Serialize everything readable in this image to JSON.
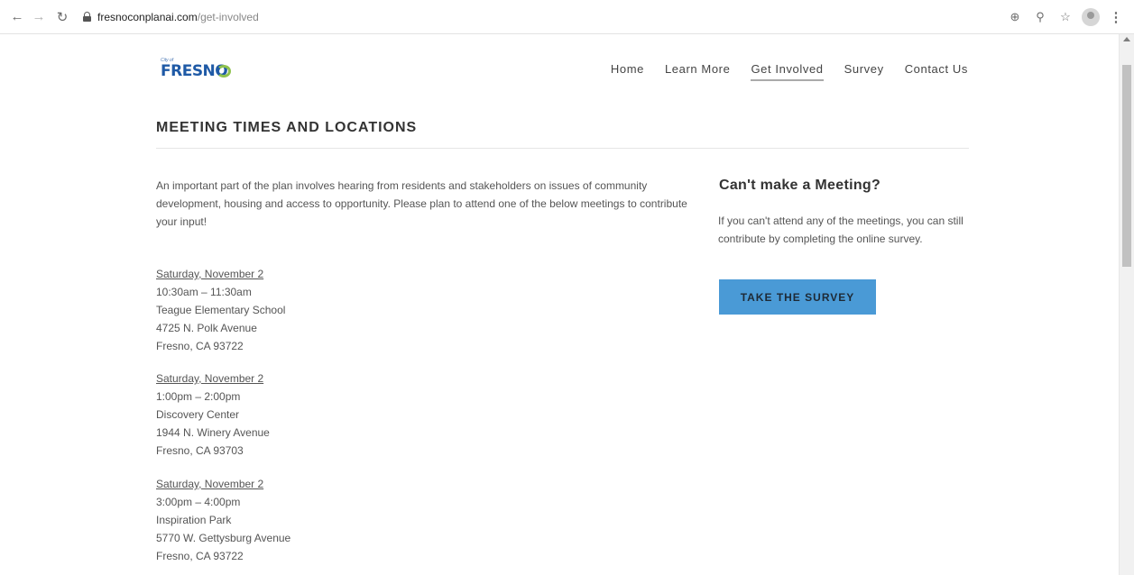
{
  "browser": {
    "url_domain": "fresnoconplanai.com",
    "url_path": "/get-involved",
    "icons": [
      "back-icon",
      "forward-icon",
      "reload-icon",
      "lock-icon",
      "zoom-add-icon",
      "search-icon",
      "star-icon",
      "profile-icon",
      "menu-icon"
    ]
  },
  "header": {
    "logo_small": "City of",
    "logo_text": "FRESNO",
    "nav": [
      {
        "label": "Home",
        "active": false
      },
      {
        "label": "Learn More",
        "active": false
      },
      {
        "label": "Get Involved",
        "active": true
      },
      {
        "label": "Survey",
        "active": false
      },
      {
        "label": "Contact Us",
        "active": false
      }
    ]
  },
  "main": {
    "title": "MEETING TIMES AND LOCATIONS",
    "intro": "An important part of the plan involves hearing from residents  and  stakeholders on issues of community development, housing and access to  opportunity.  Please plan to attend one of the below meetings to contribute your input!",
    "meetings": [
      {
        "date": "Saturday, November 2",
        "time": "10:30am – 11:30am",
        "place": "Teague  Elementary School",
        "street": "4725 N. Polk Avenue",
        "city": "Fresno, CA 93722"
      },
      {
        "date": "Saturday, November 2",
        "time": "1:00pm – 2:00pm",
        "place": "Discovery Center",
        "street": "1944 N. Winery Avenue",
        "city": "Fresno, CA 93703"
      },
      {
        "date": "Saturday, November 2",
        "time": "3:00pm – 4:00pm",
        "place": "Inspiration Park",
        "street": "5770 W. Gettysburg Avenue",
        "city": "Fresno, CA 93722"
      }
    ]
  },
  "sidebar": {
    "title": "Can't make a Meeting?",
    "text": "If you can't attend any of the meetings, you can still contribute by completing the online survey.",
    "button_label": "TAKE THE SURVEY",
    "button_color": "#4a9ad6"
  }
}
